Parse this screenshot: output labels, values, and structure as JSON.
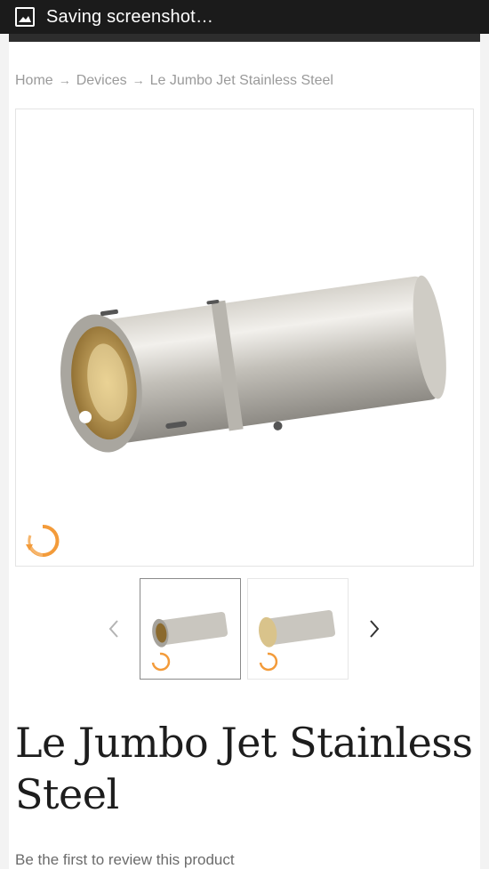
{
  "status_bar": {
    "notification_icon": "image-icon",
    "text": "Saving screenshot…"
  },
  "breadcrumb": {
    "items": [
      "Home",
      "Devices",
      "Le Jumbo Jet Stainless Steel"
    ],
    "separator": "→"
  },
  "product": {
    "main_image": "stainless-steel-cylinder",
    "badge_icon": "rotate-360-icon",
    "title": "Le Jumbo Jet Stainless Steel",
    "review_link": "Be the first to review this product"
  },
  "gallery": {
    "prev_icon": "chevron-left-icon",
    "next_icon": "chevron-right-icon",
    "thumbnails": [
      "thumbnail-side-view",
      "thumbnail-open-view"
    ],
    "active_index": 0
  },
  "colors": {
    "status_bar": "#1b1b1b",
    "top_bar": "#2d2d2d",
    "link_gray": "#9a9a9a",
    "badge_orange": "#f39b3a"
  }
}
